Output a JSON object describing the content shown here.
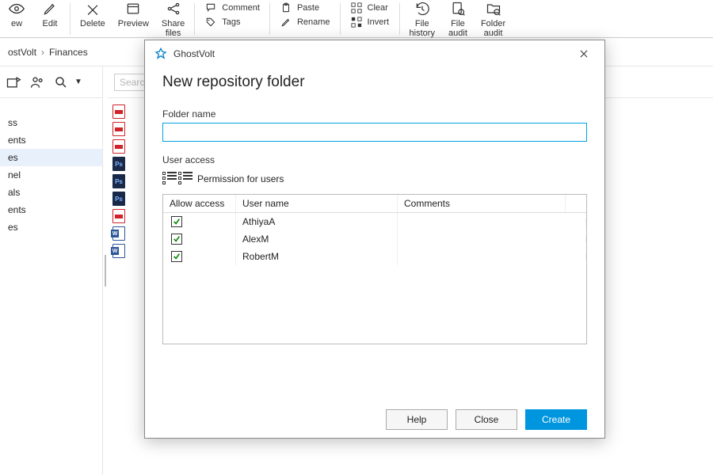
{
  "ribbon": {
    "view": "ew",
    "edit": "Edit",
    "delete": "Delete",
    "preview": "Preview",
    "share": "Share\nfiles",
    "comment": "Comment",
    "tags": "Tags",
    "paste": "Paste",
    "rename": "Rename",
    "clear": "Clear",
    "invert": "Invert",
    "file_history": "File\nhistory",
    "file_audit": "File\naudit",
    "folder_audit": "Folder\naudit"
  },
  "breadcrumb": {
    "a": "ostVolt",
    "b": "Finances"
  },
  "sidebar": {
    "items": [
      "ss",
      "ents",
      "es",
      "nel",
      "als",
      "ents",
      "es"
    ],
    "selected_index": 2
  },
  "search": {
    "placeholder": "Search"
  },
  "files": [
    "pdf",
    "pdf",
    "pdf",
    "ps",
    "ps",
    "ps",
    "pdf",
    "docx",
    "docx"
  ],
  "dialog": {
    "app": "GhostVolt",
    "title": "New repository folder",
    "folder_label": "Folder name",
    "folder_value": "",
    "access_label": "User access",
    "perm_label": "Permission for users",
    "columns": {
      "allow": "Allow access",
      "user": "User name",
      "comments": "Comments"
    },
    "rows": [
      {
        "allow": true,
        "user": "AthiyaA",
        "comments": ""
      },
      {
        "allow": true,
        "user": "AlexM",
        "comments": ""
      },
      {
        "allow": true,
        "user": "RobertM",
        "comments": ""
      }
    ],
    "help": "Help",
    "close": "Close",
    "create": "Create"
  }
}
